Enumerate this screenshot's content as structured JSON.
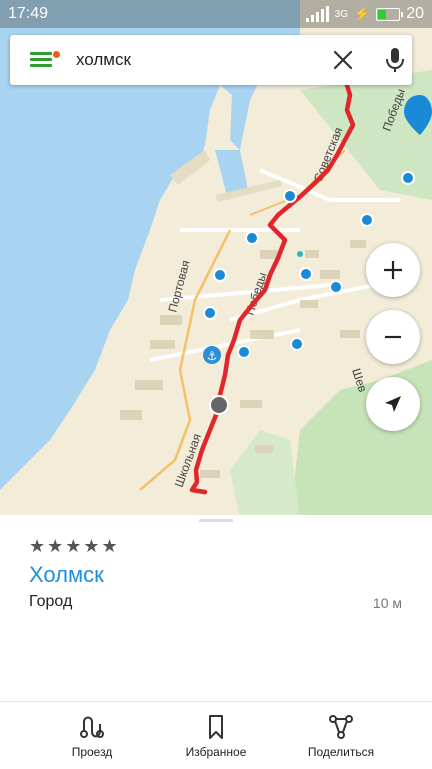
{
  "status_bar": {
    "time": "17:49",
    "network": "3G",
    "battery": "20"
  },
  "search": {
    "query": "холмск"
  },
  "map": {
    "street_labels": {
      "sovetskaya": "Советская",
      "pobedy_top": "Победы",
      "portovaya": "Портовая",
      "pobedy_mid": "Победы",
      "shkolnaya": "Школьная",
      "shev": "Шев"
    }
  },
  "place": {
    "rating_stars": "★★★★★",
    "name": "Холмск",
    "type": "Город",
    "distance": "10 м"
  },
  "bottom_nav": {
    "route_label": "Проезд",
    "favorites_label": "Избранное",
    "share_label": "Поделиться"
  },
  "colors": {
    "accent": "#1d8fe0",
    "route": "#e0262b",
    "menu": "#2e9c2e",
    "water": "#a8d4f2",
    "land": "#f2ecd9"
  },
  "icons": [
    "menu-icon",
    "close-icon",
    "mic-icon",
    "plus-icon",
    "minus-icon",
    "navigate-arrow-icon",
    "route-icon",
    "bookmark-icon",
    "share-icon",
    "anchor-icon",
    "location-pin-icon"
  ]
}
